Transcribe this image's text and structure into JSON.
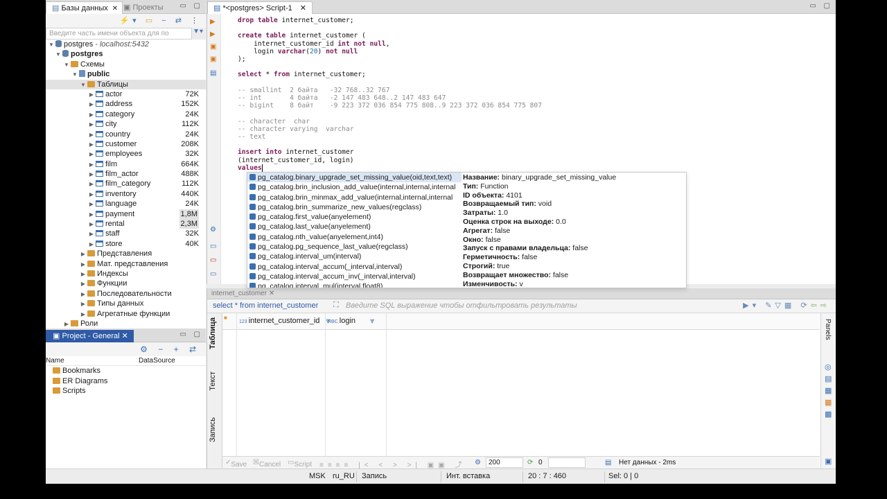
{
  "left_panel": {
    "tab_db": "Базы данных",
    "tab_projects": "Проекты",
    "filter_placeholder": "Введите часть имени объекта для по",
    "connection": "postgres",
    "connection_host": "- localhost:5432",
    "database": "postgres",
    "schemas_label": "Схемы",
    "schema": "public",
    "tables_label": "Таблицы",
    "tables": [
      {
        "name": "actor",
        "size": "72K"
      },
      {
        "name": "address",
        "size": "152K"
      },
      {
        "name": "category",
        "size": "24K"
      },
      {
        "name": "city",
        "size": "112K"
      },
      {
        "name": "country",
        "size": "24K"
      },
      {
        "name": "customer",
        "size": "208K"
      },
      {
        "name": "employees",
        "size": "32K"
      },
      {
        "name": "film",
        "size": "664K"
      },
      {
        "name": "film_actor",
        "size": "488K"
      },
      {
        "name": "film_category",
        "size": "112K"
      },
      {
        "name": "inventory",
        "size": "440K"
      },
      {
        "name": "language",
        "size": "24K"
      },
      {
        "name": "payment",
        "size": "1,8M"
      },
      {
        "name": "rental",
        "size": "2,3M"
      },
      {
        "name": "staff",
        "size": "32K"
      },
      {
        "name": "store",
        "size": "40K"
      }
    ],
    "folders": [
      "Представления",
      "Мат. представления",
      "Индексы",
      "Функции",
      "Последовательности",
      "Типы данных",
      "Агрегатные функции"
    ],
    "roles": "Роли"
  },
  "project_panel": {
    "tab": "Project - General",
    "col_name": "Name",
    "col_datasource": "DataSource",
    "items": [
      "Bookmarks",
      "ER Diagrams",
      "Scripts"
    ]
  },
  "editor": {
    "tab": "*<postgres> Script-1",
    "lines": {
      "l1a": "drop table",
      "l1b": " internet_customer;",
      "l2a": "create table",
      "l2b": " internet_customer (",
      "l3a": "    internet_customer_id ",
      "l3b": "int not null",
      "l3c": ",",
      "l4a": "    login ",
      "l4b": "varchar",
      "l4c": "(",
      "l4d": "20",
      "l4e": ") ",
      "l4f": "not null",
      "l5": ");",
      "l6a": "select",
      "l6b": " * ",
      "l6c": "from",
      "l6d": " internet_customer;",
      "c1": "-- smallint  2 байта   -32 768..32 767",
      "c2": "-- int       4 байта   -2 147 483 648..2 147 483 647",
      "c3": "-- bigint    8 байт    -9 223 372 036 854 775 808..9 223 372 036 854 775 807",
      "c4": "-- character  char",
      "c5": "-- character varying  varchar",
      "c6": "-- text",
      "l7a": "insert into",
      "l7b": " internet_customer",
      "l8": "(internet_customer_id, login)",
      "l9": "values"
    }
  },
  "autocomplete": {
    "items": [
      "pg_catalog.binary_upgrade_set_missing_value(oid,text,text)",
      "pg_catalog.brin_inclusion_add_value(internal,internal,internal",
      "pg_catalog.brin_minmax_add_value(internal,internal,internal",
      "pg_catalog.brin_summarize_new_values(regclass)",
      "pg_catalog.first_value(anyelement)",
      "pg_catalog.last_value(anyelement)",
      "pg_catalog.nth_value(anyelement,int4)",
      "pg_catalog.pg_sequence_last_value(regclass)",
      "pg_catalog.interval_um(interval)",
      "pg_catalog.interval_accum(_interval,interval)",
      "pg_catalog.interval_accum_inv(_interval,interval)",
      "pg_catalog.interval_mul(interval,float8)"
    ],
    "info": [
      {
        "k": "Название:",
        "v": " binary_upgrade_set_missing_value"
      },
      {
        "k": "Тип:",
        "v": " Function"
      },
      {
        "k": "ID объекта:",
        "v": " 4101"
      },
      {
        "k": "Возвращаемый тип:",
        "v": " void"
      },
      {
        "k": "Затраты:",
        "v": " 1.0"
      },
      {
        "k": "Оценка строк на выходе:",
        "v": " 0.0"
      },
      {
        "k": "Агрегат:",
        "v": " false"
      },
      {
        "k": "Окно:",
        "v": " false"
      },
      {
        "k": "Запуск с правами владельца:",
        "v": " false"
      },
      {
        "k": "Герметичность:",
        "v": " false"
      },
      {
        "k": "Строгий:",
        "v": " true"
      },
      {
        "k": "Возвращает множество:",
        "v": " false"
      },
      {
        "k": "Изменчивость:",
        "v": " v"
      }
    ]
  },
  "results": {
    "tab": "internet_customer",
    "query": "select * from internet_customer",
    "filter_placeholder": "Введите SQL выражение чтобы отфильтровать результаты",
    "side_tabs": [
      "Таблица",
      "Текст",
      "Запись"
    ],
    "columns": [
      {
        "type": "123",
        "name": "internet_customer_id"
      },
      {
        "type": "RBC",
        "name": "login"
      }
    ],
    "panels_label": "Panels",
    "bottom": {
      "save": "Save",
      "cancel": "Cancel",
      "script": "Script",
      "fetch_size": "200",
      "count": "0",
      "status": "Нет данных - 2ms"
    }
  },
  "status_bar": {
    "tz": "MSK",
    "locale": "ru_RU",
    "mode": "Запись",
    "insert": "Инт. вставка",
    "pos": "20 : 7 : 460",
    "sel": "Sel: 0 | 0"
  },
  "colors": {
    "accent": "#2e5aa6",
    "keyword": "#7a1c58",
    "comment": "#8c8c8c",
    "selection": "#dbe6f4"
  }
}
